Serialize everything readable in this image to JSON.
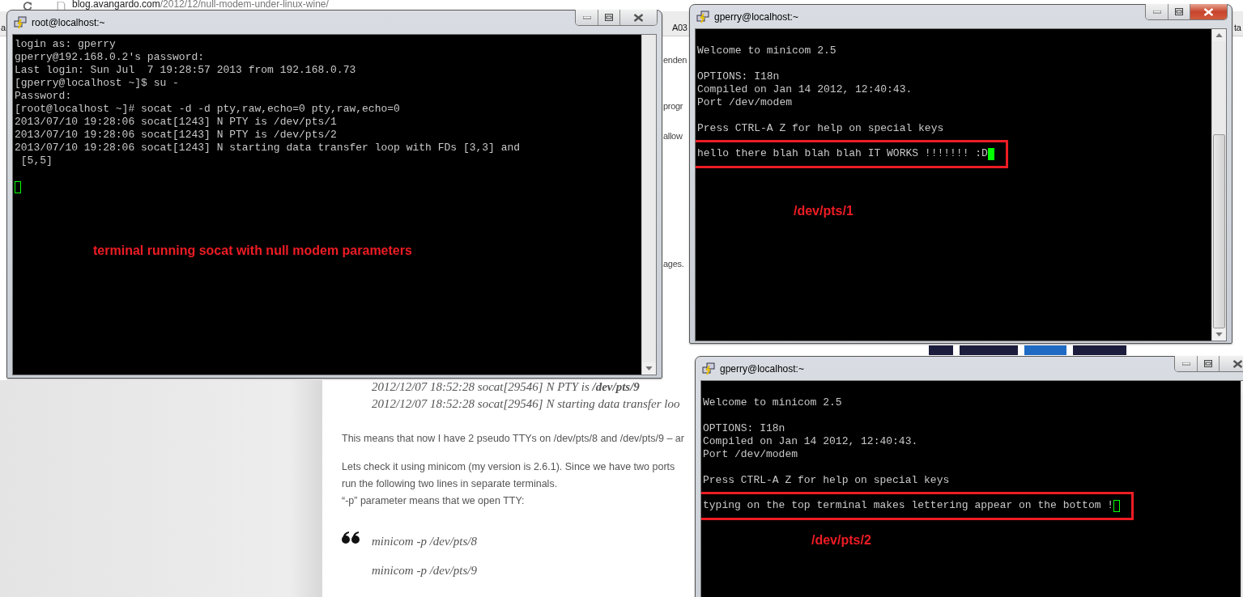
{
  "browser": {
    "url_host": "blog.avangardo.com",
    "url_path": "/2012/12/null-modem-under-linux-wine/",
    "bookmark_fragments": [
      "a",
      "A03",
      "ta"
    ],
    "side_fragments": [
      "enden",
      "progr",
      "allow",
      "ages."
    ],
    "log_lines": [
      "2012/12/07 18:52:28 socat[29546] N PTY is **/dev/pts/9**",
      "2012/12/07 18:52:28 socat[29546] N starting data transfer loo"
    ],
    "paragraphs": [
      [
        "This means that now I have 2 pseudo TTYs on /dev/pts/8 and /dev/pts/9 – ar"
      ],
      [
        "Lets check it using minicom (my version is 2.6.1). Since we have two ports",
        "run the following two lines in separate terminals.",
        "“-p” parameter means that we open TTY:"
      ]
    ],
    "quote_lines": [
      "minicom -p /dev/pts/8",
      "minicom -p /dev/pts/9"
    ]
  },
  "windows": [
    {
      "title": "root@localhost:~",
      "active": false,
      "cursor_filled": false,
      "annotation": "terminal running socat with null modem parameters",
      "paragraphs": [
        {
          "highlighted": false,
          "lines": [
            "login as: gperry",
            "gperry@192.168.0.2's password:",
            "Last login: Sun Jul  7 19:28:57 2013 from 192.168.0.73",
            "[gperry@localhost ~]$ su -",
            "Password:",
            "[root@localhost ~]# socat -d -d pty,raw,echo=0 pty,raw,echo=0",
            "2013/07/10 19:28:06 socat[1243] N PTY is /dev/pts/1",
            "2013/07/10 19:28:06 socat[1243] N PTY is /dev/pts/2",
            "2013/07/10 19:28:06 socat[1243] N starting data transfer loop with FDs [3,3] and",
            " [5,5]"
          ]
        }
      ]
    },
    {
      "title": "gperry@localhost:~",
      "active": true,
      "cursor_filled": true,
      "annotation": "/dev/pts/1",
      "paragraphs": [
        {
          "highlighted": false,
          "lines": [
            "Welcome to minicom 2.5"
          ]
        },
        {
          "highlighted": false,
          "lines": [
            "OPTIONS: I18n",
            "Compiled on Jan 14 2012, 12:40:43.",
            "Port /dev/modem"
          ]
        },
        {
          "highlighted": false,
          "lines": [
            "Press CTRL-A Z for help on special keys"
          ]
        },
        {
          "highlighted": true,
          "lines": [
            "hello there blah blah blah IT WORKS !!!!!!! :D"
          ]
        }
      ]
    },
    {
      "title": "gperry@localhost:~",
      "active": false,
      "cursor_filled": false,
      "annotation": "/dev/pts/2",
      "paragraphs": [
        {
          "highlighted": false,
          "lines": [
            "Welcome to minicom 2.5"
          ]
        },
        {
          "highlighted": false,
          "lines": [
            "OPTIONS: I18n",
            "Compiled on Jan 14 2012, 12:40:43.",
            "Port /dev/modem"
          ]
        },
        {
          "highlighted": false,
          "lines": [
            "Press CTRL-A Z for help on special keys"
          ]
        },
        {
          "highlighted": true,
          "lines": [
            "typing on the top terminal makes lettering appear on the bottom !"
          ]
        }
      ]
    }
  ]
}
